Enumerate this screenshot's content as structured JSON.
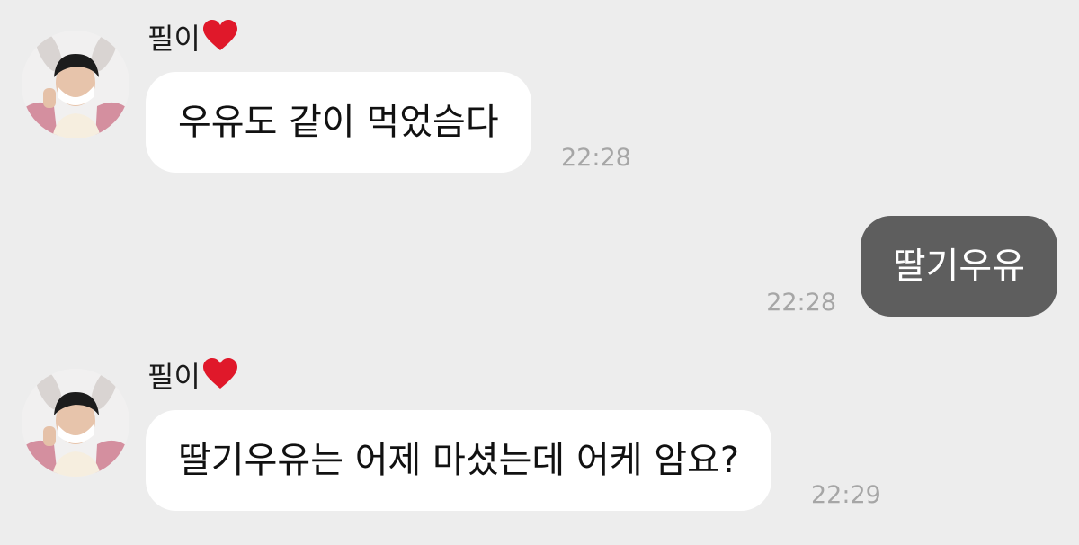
{
  "conversation": {
    "messages": [
      {
        "direction": "incoming",
        "sender": "필이",
        "sender_badge": "heart-icon",
        "text": "우유도 같이 먹었슴다",
        "time": "22:28"
      },
      {
        "direction": "outgoing",
        "text": "딸기우유",
        "time": "22:28"
      },
      {
        "direction": "incoming",
        "sender": "필이",
        "sender_badge": "heart-icon",
        "text": "딸기우유는 어제 마셨는데 어케 암요?",
        "time": "22:29"
      }
    ]
  },
  "colors": {
    "background": "#ededed",
    "incoming_bubble": "#ffffff",
    "outgoing_bubble": "#5e5e5e",
    "timestamp": "#a6a6a6",
    "heart": "#e0182a"
  }
}
